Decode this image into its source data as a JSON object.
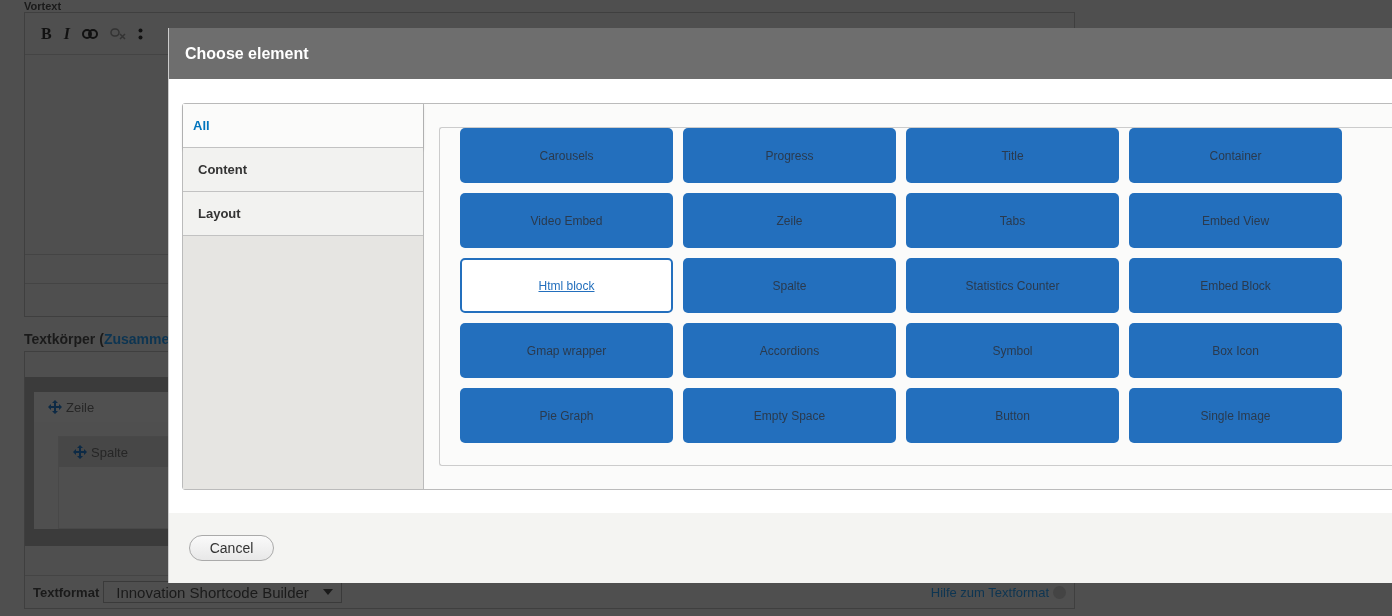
{
  "page": {
    "field_label": "Vortext",
    "toolbar": [
      {
        "label": "B",
        "kind": "bold"
      },
      {
        "label": "I",
        "kind": "italic"
      },
      {
        "kind": "link"
      },
      {
        "kind": "unlink"
      },
      {
        "kind": "list"
      }
    ],
    "body_label": "Textkörper (",
    "body_link": "Zusamme",
    "builder": {
      "row": "Zeile",
      "column": "Spalte"
    },
    "format_label": "Textformat",
    "format_value": "Innovation Shortcode Builder",
    "help_link": "Hilfe zum Textformat"
  },
  "dialog": {
    "title": "Choose element",
    "categories": [
      {
        "label": "All",
        "selected": true
      },
      {
        "label": "Content",
        "selected": false
      },
      {
        "label": "Layout",
        "selected": false
      }
    ],
    "elements": [
      {
        "label": "Carousels",
        "selected": false
      },
      {
        "label": "Progress",
        "selected": false
      },
      {
        "label": "Title",
        "selected": false
      },
      {
        "label": "Container",
        "selected": false
      },
      {
        "label": "Video Embed",
        "selected": false
      },
      {
        "label": "Zeile",
        "selected": false
      },
      {
        "label": "Tabs",
        "selected": false
      },
      {
        "label": "Embed View",
        "selected": false
      },
      {
        "label": "Html block",
        "selected": true
      },
      {
        "label": "Spalte",
        "selected": false
      },
      {
        "label": "Statistics Counter",
        "selected": false
      },
      {
        "label": "Embed Block",
        "selected": false
      },
      {
        "label": "Gmap wrapper",
        "selected": false
      },
      {
        "label": "Accordions",
        "selected": false
      },
      {
        "label": "Symbol",
        "selected": false
      },
      {
        "label": "Box Icon",
        "selected": false
      },
      {
        "label": "Pie Graph",
        "selected": false
      },
      {
        "label": "Empty Space",
        "selected": false
      },
      {
        "label": "Button",
        "selected": false
      },
      {
        "label": "Single Image",
        "selected": false
      }
    ],
    "cancel": "Cancel"
  }
}
